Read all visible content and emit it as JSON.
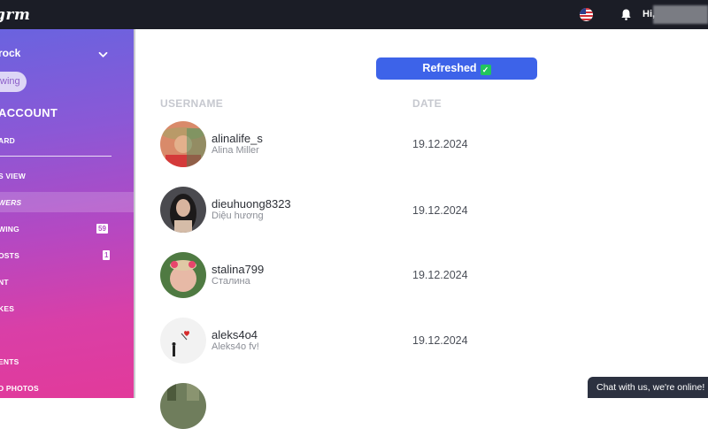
{
  "topbar": {
    "logo": "grm",
    "greeting": "Hi,"
  },
  "sidebar": {
    "account_name": "rock",
    "pill": "wing",
    "section_title": "ACCOUNT",
    "items": [
      {
        "label": "ARD",
        "badge": null
      },
      {
        "label": "S VIEW",
        "badge": null
      },
      {
        "label": "WERS",
        "badge": null
      },
      {
        "label": "WING",
        "badge": "59"
      },
      {
        "label": "OSTS",
        "badge": "1"
      },
      {
        "label": "NT",
        "badge": null
      },
      {
        "label": "KES",
        "badge": null
      },
      {
        "label": "ENTS",
        "badge": null
      },
      {
        "label": "D PHOTOS",
        "badge": null
      }
    ]
  },
  "main": {
    "refresh_label": "Refreshed",
    "columns": {
      "username": "USERNAME",
      "date": "DATE"
    },
    "rows": [
      {
        "username": "alinalife_s",
        "display_name": "Alina Miller",
        "date": "19.12.2024"
      },
      {
        "username": "dieuhuong8323",
        "display_name": "Diệu hương",
        "date": "19.12.2024"
      },
      {
        "username": "stalina799",
        "display_name": "Сталина",
        "date": "19.12.2024"
      },
      {
        "username": "aleks4o4",
        "display_name": "Aleks4o fv!",
        "date": "19.12.2024"
      }
    ]
  },
  "chat": {
    "label": "Chat with us, we're online!"
  },
  "colors": {
    "accent": "#3d63e9",
    "topbar": "#1b1d26",
    "success": "#22c55e"
  }
}
